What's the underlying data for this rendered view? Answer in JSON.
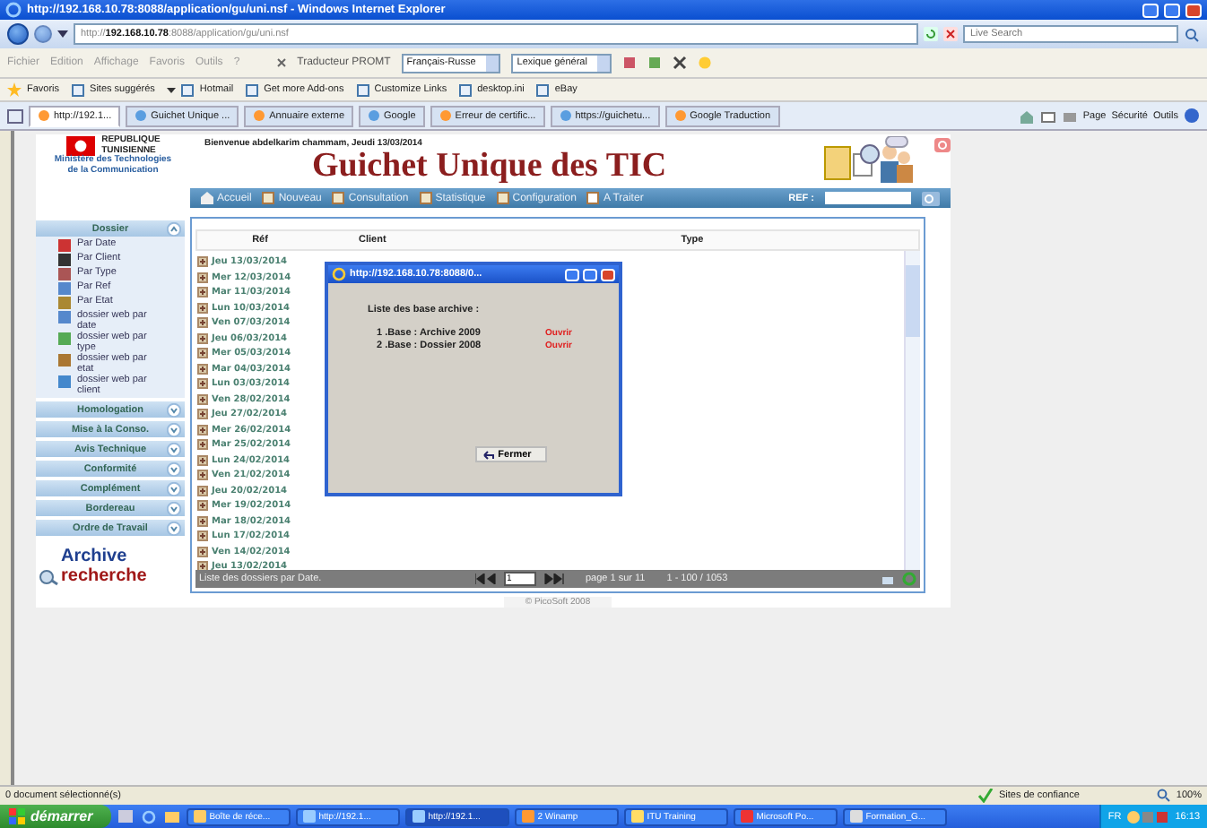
{
  "browser": {
    "title": "http://192.168.10.78:8088/application/gu/uni.nsf - Windows Internet Explorer",
    "address": "http://**192.168.10.78**:8088/application/gu/uni.nsf",
    "search": {
      "placeholder": "Live Search"
    },
    "menu": [
      "Fichier",
      "Edition",
      "Affichage",
      "Favoris",
      "Outils",
      "?"
    ],
    "translator": {
      "label": "Traducteur PROMT",
      "language": "Français-Russe",
      "lexicon": "Lexique général"
    },
    "favorites": [
      "Favoris",
      "Sites suggérés",
      "Hotmail",
      "Get more Add-ons",
      "Customize Links",
      "desktop.ini",
      "eBay"
    ],
    "tabs": [
      {
        "label": "http://192.1...",
        "selected": true
      },
      {
        "label": "Guichet Unique ...",
        "selected": false
      },
      {
        "label": "Annuaire externe",
        "selected": false
      },
      {
        "label": "Google",
        "selected": false
      },
      {
        "label": "Erreur de certific...",
        "selected": false
      },
      {
        "label": "https://guichetu...",
        "selected": false
      },
      {
        "label": "Google Traduction",
        "selected": false
      }
    ],
    "commands": [
      "Page",
      "Sécurité",
      "Outils"
    ]
  },
  "page": {
    "logo": {
      "country_line1": "REPUBLIQUE",
      "country_line2": "TUNISIENNE",
      "ministry_line1": "Ministère des Technologies",
      "ministry_line2": "de la Communication"
    },
    "welcome": "Bienvenue abdelkarim chammam, Jeudi 13/03/2014",
    "title": "Guichet Unique des TIC",
    "nav": [
      "Accueil",
      "Nouveau",
      "Consultation",
      "Statistique",
      "Configuration",
      "A Traiter"
    ],
    "ref_label": "REF :",
    "sidebar": [
      {
        "label": "Dossier",
        "expanded": true,
        "items": [
          "Par Date",
          "Par Client",
          "Par Type",
          "Par Ref",
          "Par Etat",
          "dossier web par date",
          "dossier web par type",
          "dossier web par etat",
          "dossier web par client"
        ]
      },
      {
        "label": "Homologation",
        "expanded": false
      },
      {
        "label": "Mise à la Conso.",
        "expanded": false
      },
      {
        "label": "Avis Technique",
        "expanded": false
      },
      {
        "label": "Conformité",
        "expanded": false
      },
      {
        "label": "Complément",
        "expanded": false
      },
      {
        "label": "Bordereau",
        "expanded": false
      },
      {
        "label": "Ordre de Travail",
        "expanded": false
      }
    ],
    "archive": "Archive",
    "search_link": "recherche",
    "grid": {
      "columns": [
        "Réf",
        "Client",
        "Type"
      ],
      "rows": [
        "Jeu 13/03/2014",
        "Mer 12/03/2014",
        "Mar 11/03/2014",
        "Lun 10/03/2014",
        "Ven 07/03/2014",
        "Jeu 06/03/2014",
        "Mer 05/03/2014",
        "Mar 04/03/2014",
        "Lun 03/03/2014",
        "Ven 28/02/2014",
        "Jeu 27/02/2014",
        "Mer 26/02/2014",
        "Mar 25/02/2014",
        "Lun 24/02/2014",
        "Ven 21/02/2014",
        "Jeu 20/02/2014",
        "Mer 19/02/2014",
        "Mar 18/02/2014",
        "Lun 17/02/2014",
        "Ven 14/02/2014",
        "Jeu 13/02/2014"
      ],
      "caption": "Liste des dossiers par Date.",
      "page_input": "1",
      "page_text": "page 1 sur 11",
      "range": "1 - 100 / 1053"
    },
    "copyright": "© PicoSoft 2008",
    "popup": {
      "title": "http://192.168.10.78:8088/0...",
      "heading": "Liste des base archive :",
      "items": [
        {
          "label": "1 .Base : Archive 2009",
          "action": "Ouvrir"
        },
        {
          "label": "2 .Base : Dossier 2008",
          "action": "Ouvrir"
        }
      ],
      "close_button": "Fermer"
    }
  },
  "status_bar": {
    "text": "0 document sélectionné(s)",
    "zone": "Sites de confiance",
    "zoom": "100%"
  },
  "taskbar": {
    "start": "démarrer",
    "tasks": [
      {
        "label": "Boîte de réce...",
        "selected": false
      },
      {
        "label": "http://192.1...",
        "selected": false
      },
      {
        "label": "http://192.1...",
        "selected": true
      },
      {
        "label": "2 Winamp",
        "selected": false
      },
      {
        "label": "ITU Training",
        "selected": false
      },
      {
        "label": "Microsoft Po...",
        "selected": false
      },
      {
        "label": "Formation_G...",
        "selected": false
      }
    ],
    "language": "FR",
    "clock": "16:13"
  }
}
